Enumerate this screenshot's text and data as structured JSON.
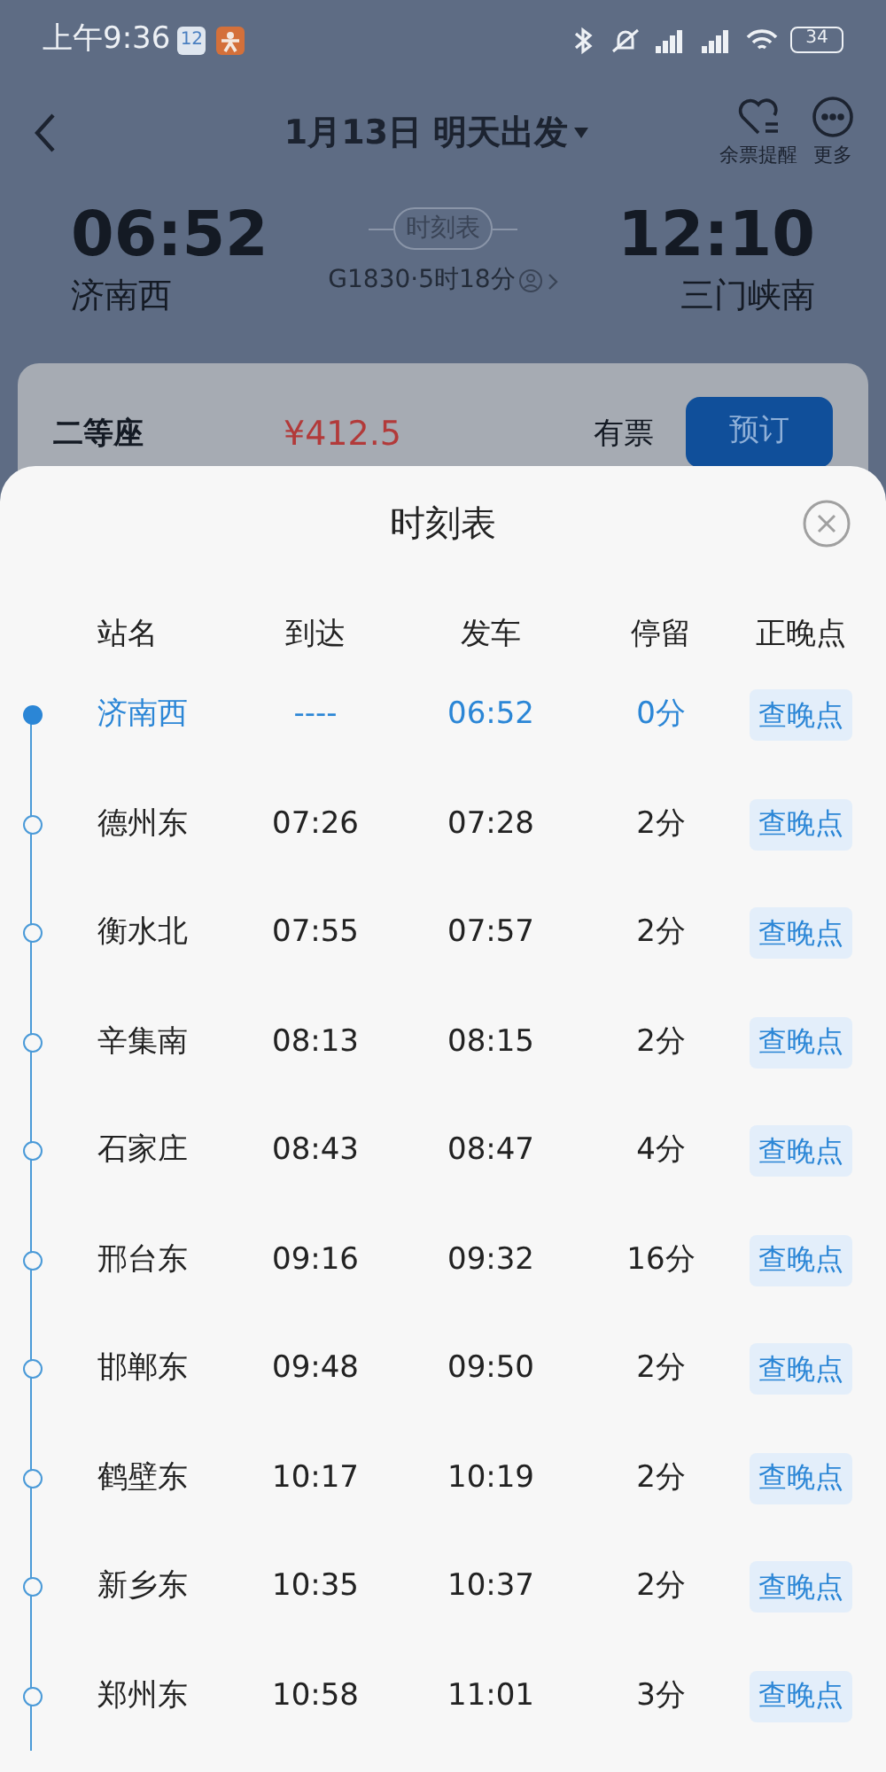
{
  "status_bar": {
    "time": "上午9:36",
    "calendar_badge": "12",
    "battery": "34"
  },
  "header": {
    "title": "1月13日 明天出发",
    "actions": [
      {
        "kind": "alert",
        "label": "余票提醒"
      },
      {
        "kind": "more",
        "label": "更多"
      }
    ]
  },
  "trip": {
    "depart_time": "06:52",
    "depart_station": "济南西",
    "timetable_link": "时刻表",
    "train_info": "G1830·5时18分",
    "arrive_time": "12:10",
    "arrive_station": "三门峡南"
  },
  "seat": {
    "class": "二等座",
    "price": "¥412.5",
    "availability": "有票",
    "book_button": "预订"
  },
  "sheet": {
    "title": "时刻表",
    "columns": [
      "站名",
      "到达",
      "发车",
      "停留",
      "正晚点"
    ],
    "rows": [
      {
        "station": "济南西",
        "arrive": "----",
        "depart": "06:52",
        "stop": "0分",
        "action": "查晚点",
        "current": true
      },
      {
        "station": "德州东",
        "arrive": "07:26",
        "depart": "07:28",
        "stop": "2分",
        "action": "查晚点",
        "current": false
      },
      {
        "station": "衡水北",
        "arrive": "07:55",
        "depart": "07:57",
        "stop": "2分",
        "action": "查晚点",
        "current": false
      },
      {
        "station": "辛集南",
        "arrive": "08:13",
        "depart": "08:15",
        "stop": "2分",
        "action": "查晚点",
        "current": false
      },
      {
        "station": "石家庄",
        "arrive": "08:43",
        "depart": "08:47",
        "stop": "4分",
        "action": "查晚点",
        "current": false
      },
      {
        "station": "邢台东",
        "arrive": "09:16",
        "depart": "09:32",
        "stop": "16分",
        "action": "查晚点",
        "current": false
      },
      {
        "station": "邯郸东",
        "arrive": "09:48",
        "depart": "09:50",
        "stop": "2分",
        "action": "查晚点",
        "current": false
      },
      {
        "station": "鹤壁东",
        "arrive": "10:17",
        "depart": "10:19",
        "stop": "2分",
        "action": "查晚点",
        "current": false
      },
      {
        "station": "新乡东",
        "arrive": "10:35",
        "depart": "10:37",
        "stop": "2分",
        "action": "查晚点",
        "current": false
      },
      {
        "station": "郑州东",
        "arrive": "10:58",
        "depart": "11:01",
        "stop": "3分",
        "action": "查晚点",
        "current": false
      }
    ]
  }
}
